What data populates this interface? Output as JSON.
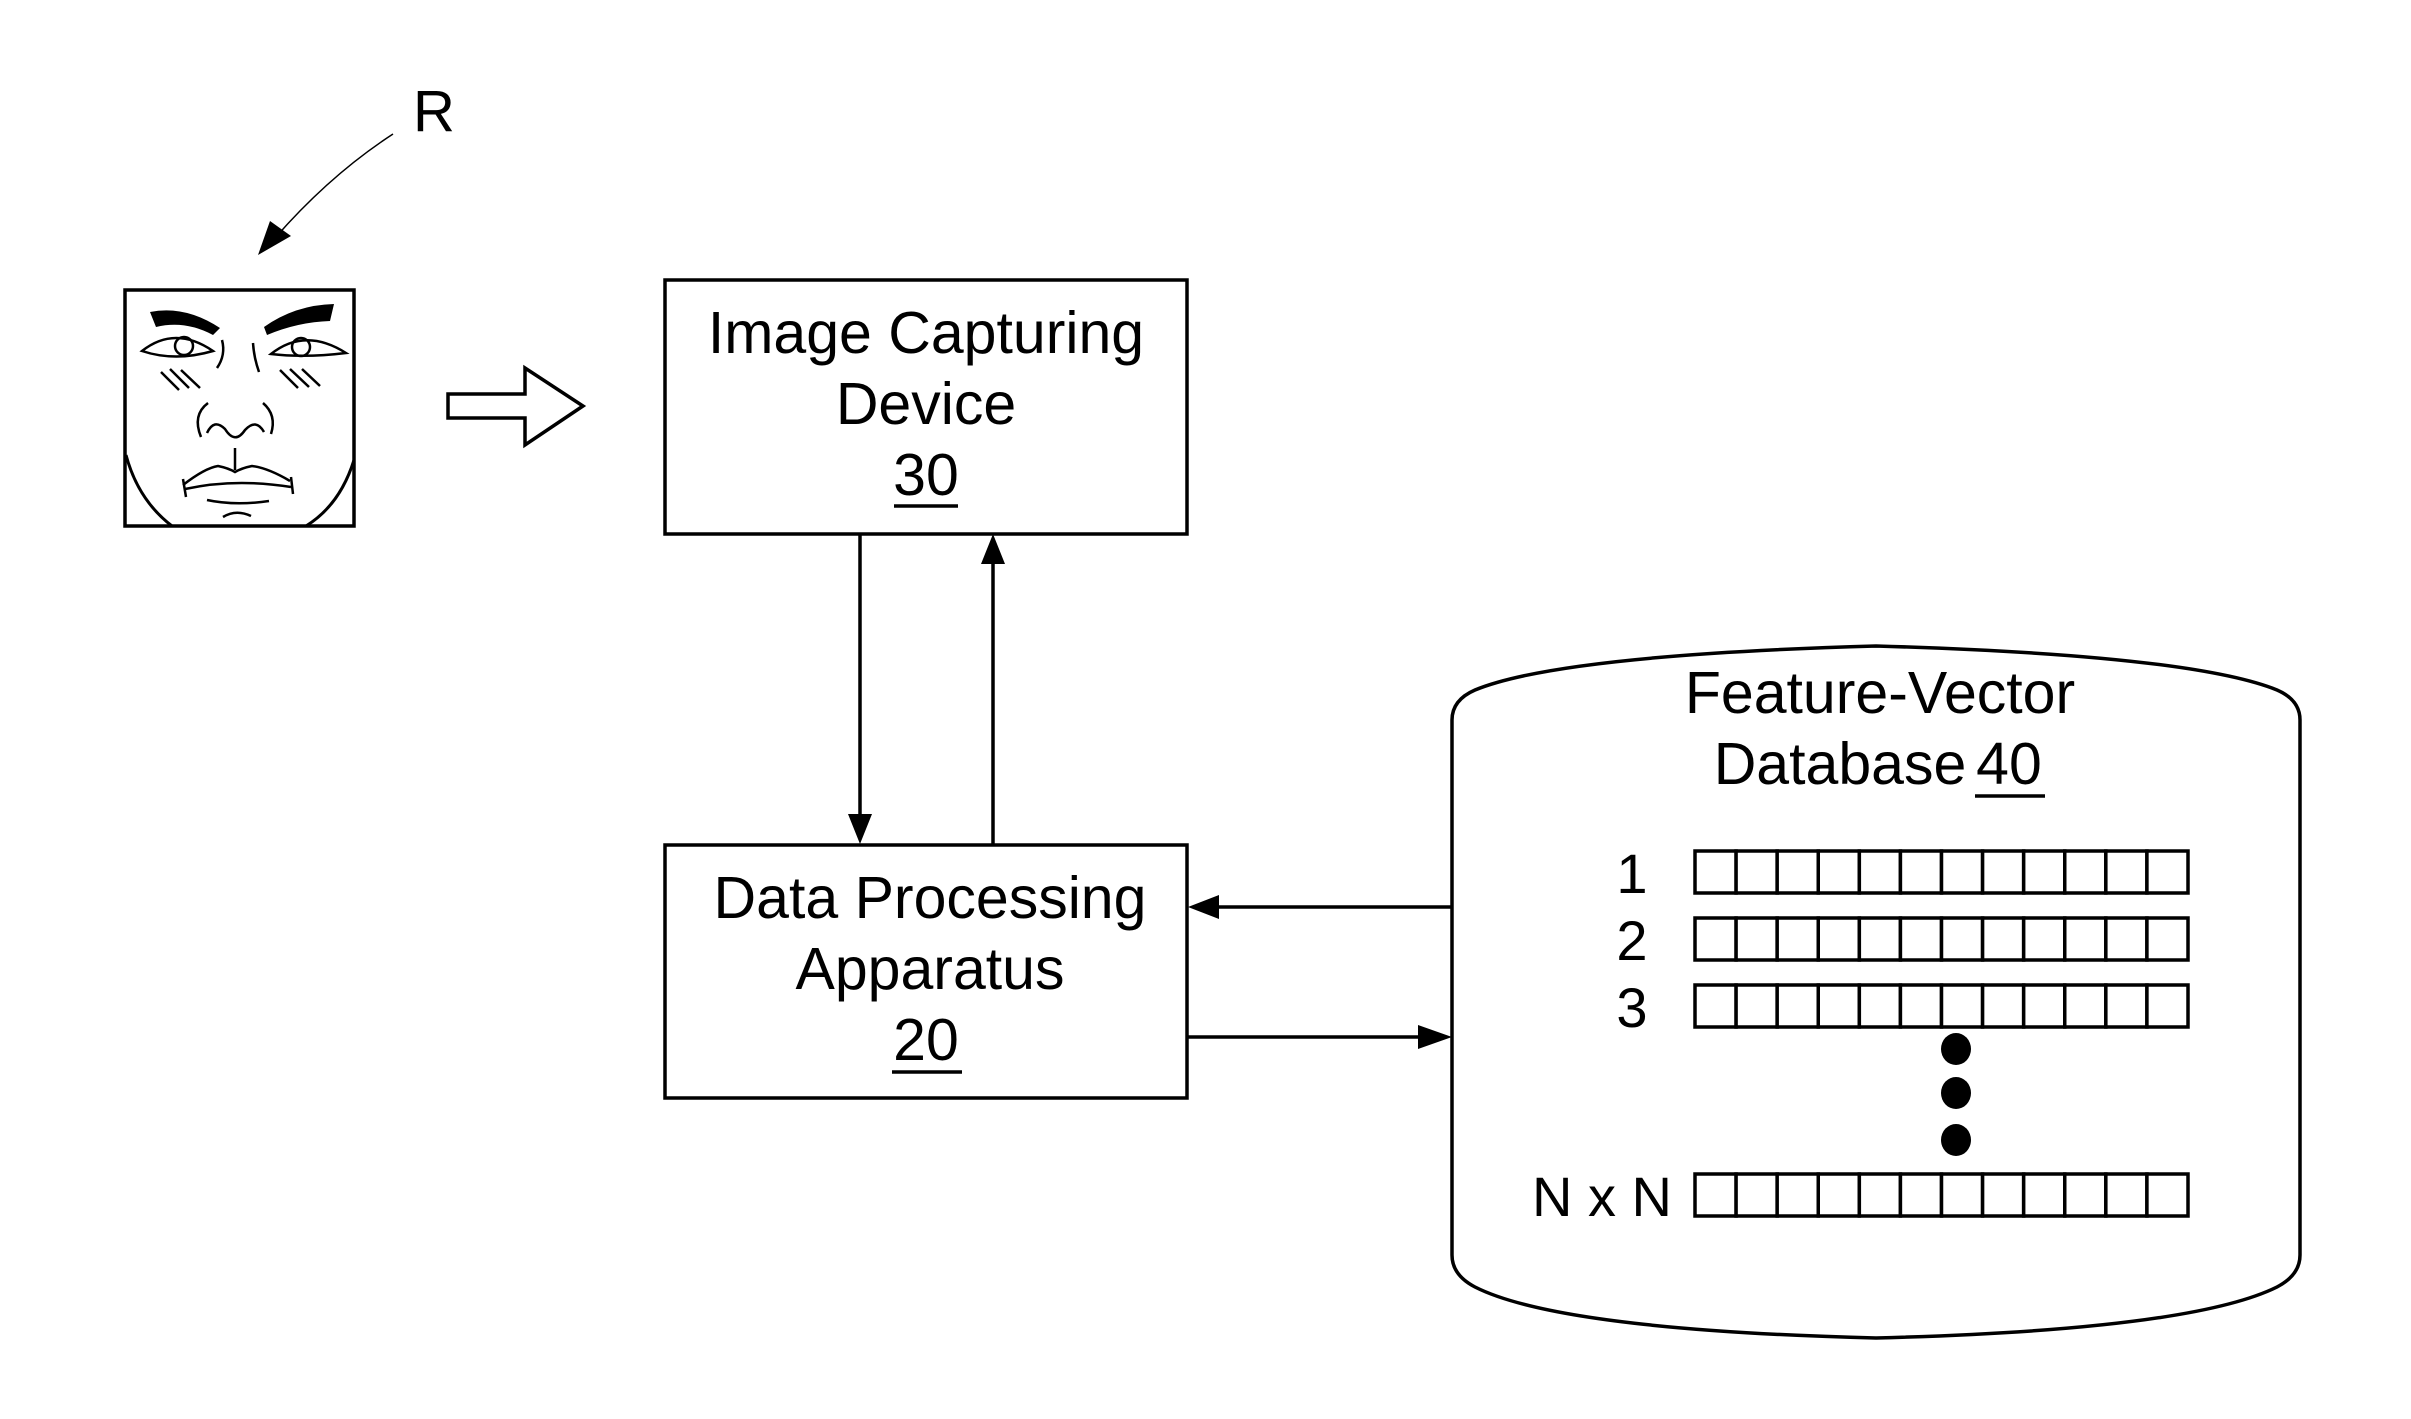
{
  "diagram": {
    "type": "block-diagram",
    "colors": {
      "ink": "#000000",
      "background": "#ffffff"
    },
    "subject": {
      "label": "R",
      "icon": "face-sketch-icon"
    },
    "input_arrow": {
      "icon": "hollow-right-arrow-icon"
    },
    "image_capturing_device": {
      "line1": "Image Capturing",
      "line2": "Device",
      "ref": "30"
    },
    "data_processing_apparatus": {
      "line1": "Data Processing",
      "line2": "Apparatus",
      "ref": "20"
    },
    "database": {
      "line1": "Feature-Vector",
      "line2": "Database",
      "ref": "40",
      "cells_per_row": 12,
      "rows": [
        {
          "label": "1"
        },
        {
          "label": "2"
        },
        {
          "label": "3"
        },
        {
          "label": "N x N"
        }
      ],
      "ellipsis_dots": 3
    },
    "connections": [
      {
        "from": "image_capturing_device",
        "to": "data_processing_apparatus",
        "direction": "down"
      },
      {
        "from": "data_processing_apparatus",
        "to": "image_capturing_device",
        "direction": "up"
      },
      {
        "from": "database",
        "to": "data_processing_apparatus",
        "direction": "left"
      },
      {
        "from": "data_processing_apparatus",
        "to": "database",
        "direction": "right"
      }
    ]
  }
}
